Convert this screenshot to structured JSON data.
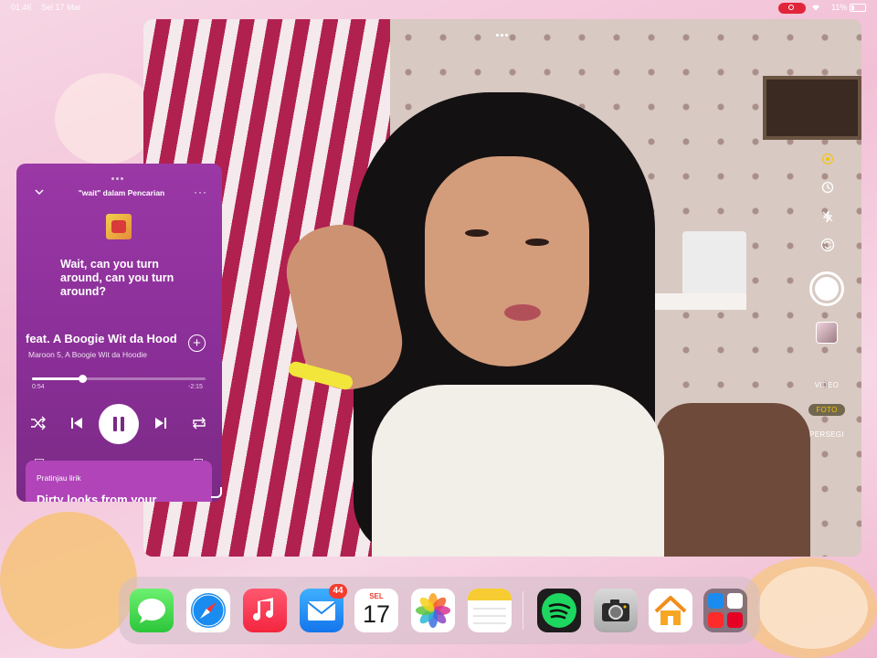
{
  "status_bar": {
    "time": "01.46",
    "date": "Sel 17 Mar",
    "battery": "11%"
  },
  "music_player": {
    "header_title": "\"wait\" dalam Pencarian",
    "lyric": "Wait, can you turn around, can you turn around?",
    "track_title": "feat. A Boogie Wit da Hoodie",
    "track_artist": "Maroon 5, A Boogie Wit da Hoodie",
    "elapsed": "0:54",
    "remaining": "-2:15",
    "progress_fraction": 0.29,
    "lyrics_card_label": "Pratinjau lirik",
    "lyrics_card_preview": "Dirty looks from your"
  },
  "camera": {
    "modes": [
      "VIDEO",
      "FOTO",
      "PERSEGI"
    ],
    "selected_mode": "FOTO",
    "accent": "#f5c400"
  },
  "dock": {
    "apps": [
      "messages",
      "safari",
      "music",
      "mail",
      "calendar",
      "photos",
      "notes",
      "spotify",
      "camera",
      "home",
      "app-library"
    ],
    "mail_badge": "44",
    "calendar_month": "SEL",
    "calendar_day": "17"
  }
}
